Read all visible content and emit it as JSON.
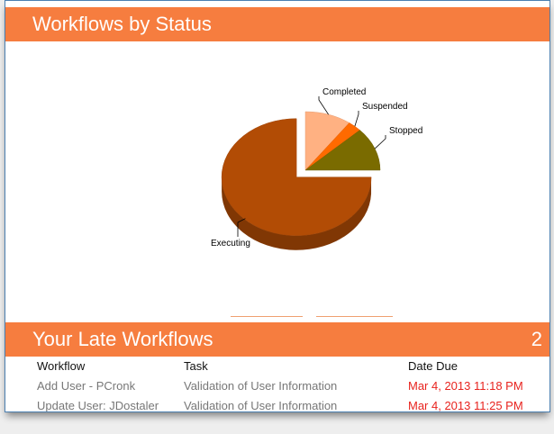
{
  "panels": {
    "status": {
      "title": "Workflows by Status"
    },
    "late": {
      "title": "Your Late Workflows",
      "count": "2"
    }
  },
  "chart_data": {
    "type": "pie",
    "categories": [
      "Completed",
      "Suspended",
      "Stopped",
      "Executing"
    ],
    "values": [
      10,
      3,
      12,
      75
    ],
    "colors": [
      "#ffb182",
      "#ff6a00",
      "#7a6b00",
      "#b24c05"
    ],
    "exploded": "Executing"
  },
  "table": {
    "columns": [
      "Workflow",
      "Task",
      "Date Due"
    ],
    "rows": [
      [
        "Add User - PCronk",
        "Validation of User Information",
        "Mar 4, 2013 11:18 PM"
      ],
      [
        "Update User: JDostaler",
        "Validation of User Information",
        "Mar 4, 2013 11:25 PM"
      ]
    ]
  }
}
